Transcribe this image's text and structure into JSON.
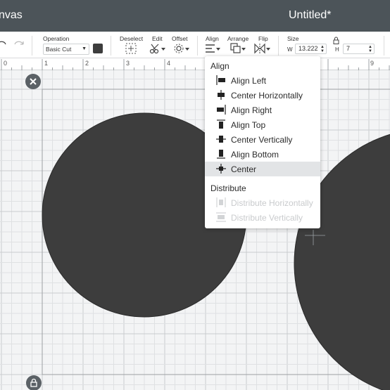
{
  "titlebar": {
    "app_title": "nvas",
    "doc_title": "Untitled*"
  },
  "toolbar": {
    "operation_label": "Operation",
    "operation_value": "Basic Cut",
    "deselect_label": "Deselect",
    "edit_label": "Edit",
    "offset_label": "Offset",
    "align_label": "Align",
    "arrange_label": "Arrange",
    "flip_label": "Flip",
    "size_label": "Size",
    "width_label": "W",
    "width_value": "13.222",
    "height_label": "H",
    "height_value": "7",
    "swatch_color": "#3d3d3d"
  },
  "ruler": {
    "numbers": [
      "0",
      "1",
      "2",
      "3",
      "4",
      "9"
    ]
  },
  "align_menu": {
    "align_heading": "Align",
    "items": [
      {
        "label": "Align Left",
        "icon": "align-left-icon"
      },
      {
        "label": "Center Horizontally",
        "icon": "center-horizontally-icon"
      },
      {
        "label": "Align Right",
        "icon": "align-right-icon"
      },
      {
        "label": "Align Top",
        "icon": "align-top-icon"
      },
      {
        "label": "Center Vertically",
        "icon": "center-vertically-icon"
      },
      {
        "label": "Align Bottom",
        "icon": "align-bottom-icon"
      },
      {
        "label": "Center",
        "icon": "center-icon",
        "highlighted": true
      }
    ],
    "distribute_heading": "Distribute",
    "distribute_items": [
      {
        "label": "Distribute Horizontally",
        "icon": "distribute-horizontally-icon",
        "disabled": true
      },
      {
        "label": "Distribute Vertically",
        "icon": "distribute-vertically-icon",
        "disabled": true
      }
    ]
  },
  "colors": {
    "header": "#4c5459",
    "shape_fill": "#3d3d3d",
    "menu_highlight": "#e2e4e6",
    "grid_minor": "#dfe1e3",
    "grid_major": "#c9ccce"
  }
}
